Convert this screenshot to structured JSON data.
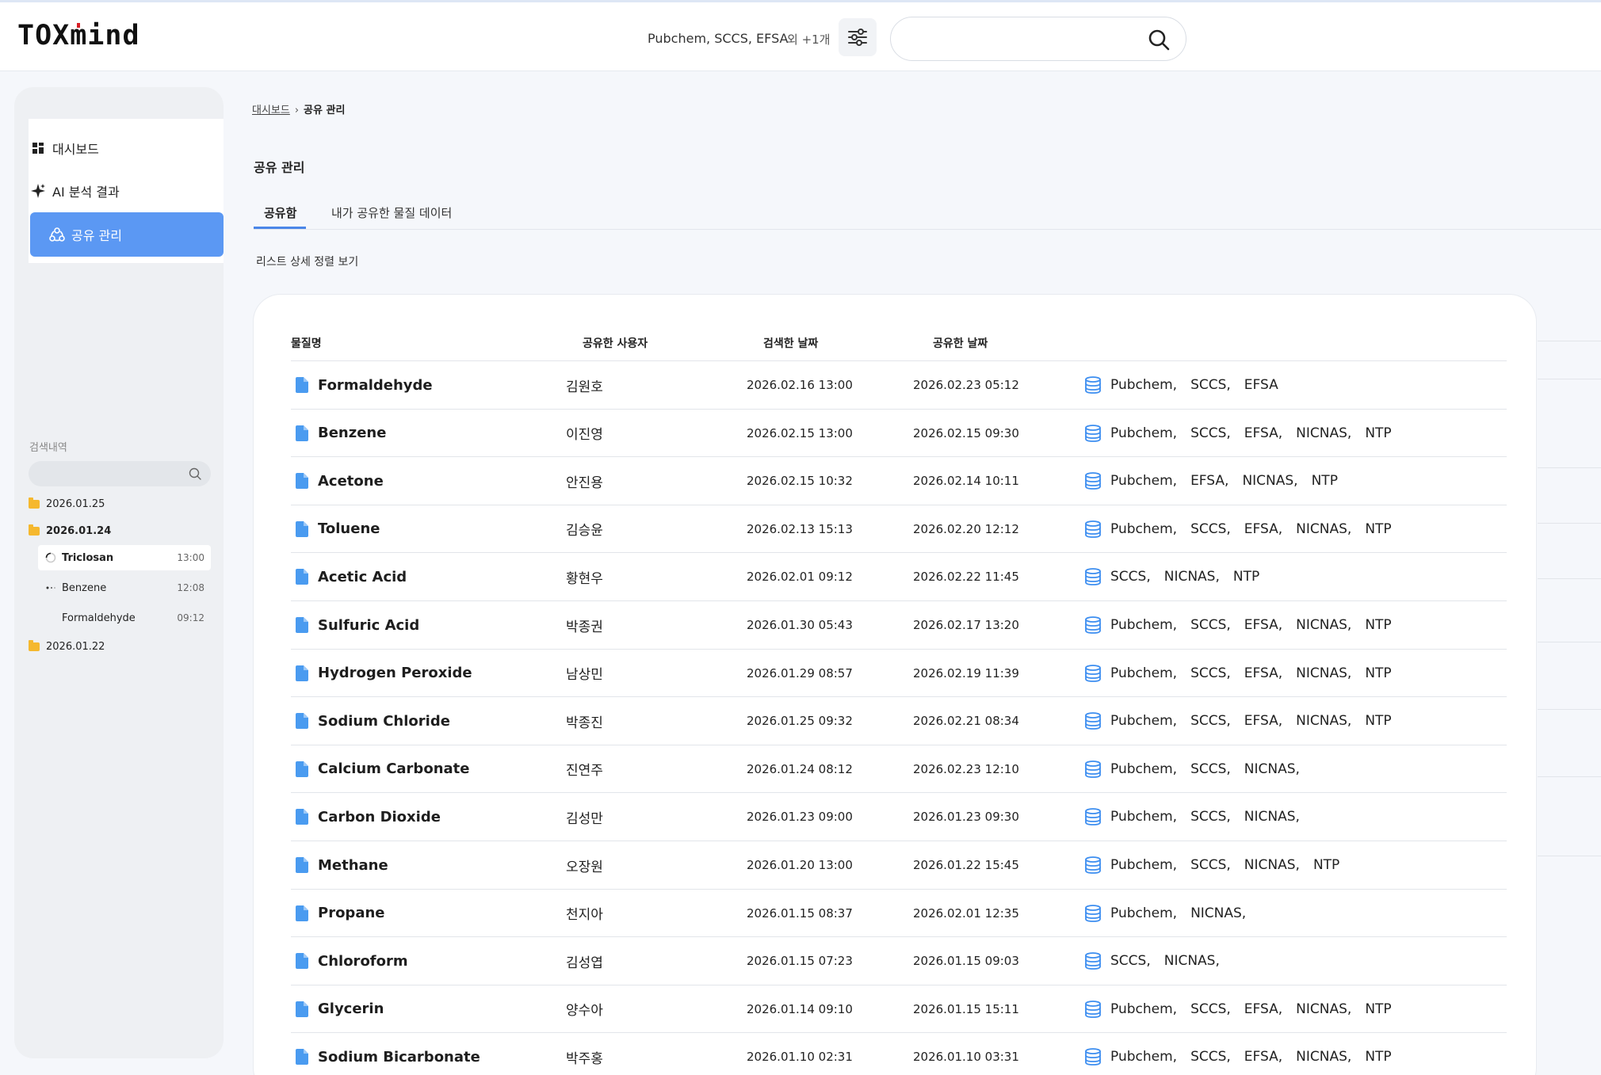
{
  "header": {
    "logo": "TOXmind",
    "sources_text": "Pubchem, SCCS, EFSA",
    "sources_more": "외 +1개",
    "search_placeholder": ""
  },
  "sidebar": {
    "nav": [
      {
        "label": "대시보드",
        "icon": "dashboard-grid-icon"
      },
      {
        "label": "AI 분석 결과",
        "icon": "sparkle-icon"
      },
      {
        "label": "공유 관리",
        "icon": "share-icon",
        "active": true
      }
    ],
    "history_label": "검색내역",
    "history_search_placeholder": "",
    "history": [
      {
        "date": "2026.01.25",
        "bold": false,
        "items": []
      },
      {
        "date": "2026.01.24",
        "bold": true,
        "items": [
          {
            "name": "Triclosan",
            "time": "13:00",
            "selected": true
          },
          {
            "name": "Benzene",
            "time": "12:08"
          },
          {
            "name": "Formaldehyde",
            "time": "09:12"
          }
        ]
      },
      {
        "date": "2026.01.22",
        "bold": false,
        "items": []
      }
    ]
  },
  "breadcrumb": {
    "home": "대시보드",
    "sep": "›",
    "current": "공유 관리"
  },
  "page_title": "공유 관리",
  "tabs": [
    {
      "label": "공유함",
      "active": true
    },
    {
      "label": "내가 공유한 물질 데이터",
      "active": false
    }
  ],
  "list_sort_label": "리스트 상세 정렬 보기",
  "table": {
    "headers": [
      "물질명",
      "공유한 사용자",
      "검색한 날짜",
      "공유한 날짜"
    ],
    "rows": [
      {
        "name": "Formaldehyde",
        "user": "김원호",
        "searched": "2026.02.16 13:00",
        "shared": "2026.02.23 05:12",
        "sources": [
          "Pubchem,",
          "SCCS,",
          "EFSA"
        ]
      },
      {
        "name": "Benzene",
        "user": "이진영",
        "searched": "2026.02.15 13:00",
        "shared": "2026.02.15 09:30",
        "sources": [
          "Pubchem,",
          "SCCS,",
          "EFSA,",
          "NICNAS,",
          "NTP"
        ]
      },
      {
        "name": "Acetone",
        "user": "안진용",
        "searched": "2026.02.15 10:32",
        "shared": "2026.02.14 10:11",
        "sources": [
          "Pubchem,",
          "EFSA,",
          "NICNAS,",
          "NTP"
        ]
      },
      {
        "name": "Toluene",
        "user": "김승윤",
        "searched": "2026.02.13 15:13",
        "shared": "2026.02.20 12:12",
        "sources": [
          "Pubchem,",
          "SCCS,",
          "EFSA,",
          "NICNAS,",
          "NTP"
        ]
      },
      {
        "name": "Acetic Acid",
        "user": "황현우",
        "searched": "2026.02.01 09:12",
        "shared": "2026.02.22 11:45",
        "sources": [
          "SCCS,",
          "NICNAS,",
          "NTP"
        ]
      },
      {
        "name": "Sulfuric Acid",
        "user": "박종권",
        "searched": "2026.01.30 05:43",
        "shared": "2026.02.17 13:20",
        "sources": [
          "Pubchem,",
          "SCCS,",
          "EFSA,",
          "NICNAS,",
          "NTP"
        ]
      },
      {
        "name": "Hydrogen Peroxide",
        "user": "남상민",
        "searched": "2026.01.29 08:57",
        "shared": "2026.02.19 11:39",
        "sources": [
          "Pubchem,",
          "SCCS,",
          "EFSA,",
          "NICNAS,",
          "NTP"
        ]
      },
      {
        "name": "Sodium Chloride",
        "user": "박종진",
        "searched": "2026.01.25 09:32",
        "shared": "2026.02.21 08:34",
        "sources": [
          "Pubchem,",
          "SCCS,",
          "EFSA,",
          "NICNAS,",
          "NTP"
        ]
      },
      {
        "name": "Calcium Carbonate",
        "user": "진연주",
        "searched": "2026.01.24 08:12",
        "shared": "2026.02.23 12:10",
        "sources": [
          "Pubchem,",
          "SCCS,",
          "NICNAS,"
        ]
      },
      {
        "name": "Carbon Dioxide",
        "user": "김성만",
        "searched": "2026.01.23 09:00",
        "shared": "2026.01.23 09:30",
        "sources": [
          "Pubchem,",
          "SCCS,",
          "NICNAS,"
        ]
      },
      {
        "name": "Methane",
        "user": "오장원",
        "searched": "2026.01.20 13:00",
        "shared": "2026.01.22 15:45",
        "sources": [
          "Pubchem,",
          "SCCS,",
          "NICNAS,",
          "NTP"
        ]
      },
      {
        "name": "Propane",
        "user": "천지아",
        "searched": "2026.01.15 08:37",
        "shared": "2026.02.01 12:35",
        "sources": [
          "Pubchem,",
          "NICNAS,"
        ]
      },
      {
        "name": "Chloroform",
        "user": "김성엽",
        "searched": "2026.01.15 07:23",
        "shared": "2026.01.15 09:03",
        "sources": [
          "SCCS,",
          "NICNAS,"
        ]
      },
      {
        "name": "Glycerin",
        "user": "양수아",
        "searched": "2026.01.14 09:10",
        "shared": "2026.01.15 15:11",
        "sources": [
          "Pubchem,",
          "SCCS,",
          "EFSA,",
          "NICNAS,",
          "NTP"
        ]
      },
      {
        "name": "Sodium Bicarbonate",
        "user": "박주홍",
        "searched": "2026.01.10 02:31",
        "shared": "2026.01.10 03:31",
        "sources": [
          "Pubchem,",
          "SCCS,",
          "EFSA,",
          "NICNAS,",
          "NTP"
        ]
      }
    ]
  },
  "colors": {
    "accent": "#5b98f3",
    "tab_underline": "#4a86e8",
    "folder_yellow": "#f5b82e",
    "file_blue": "#4a9bf0"
  }
}
